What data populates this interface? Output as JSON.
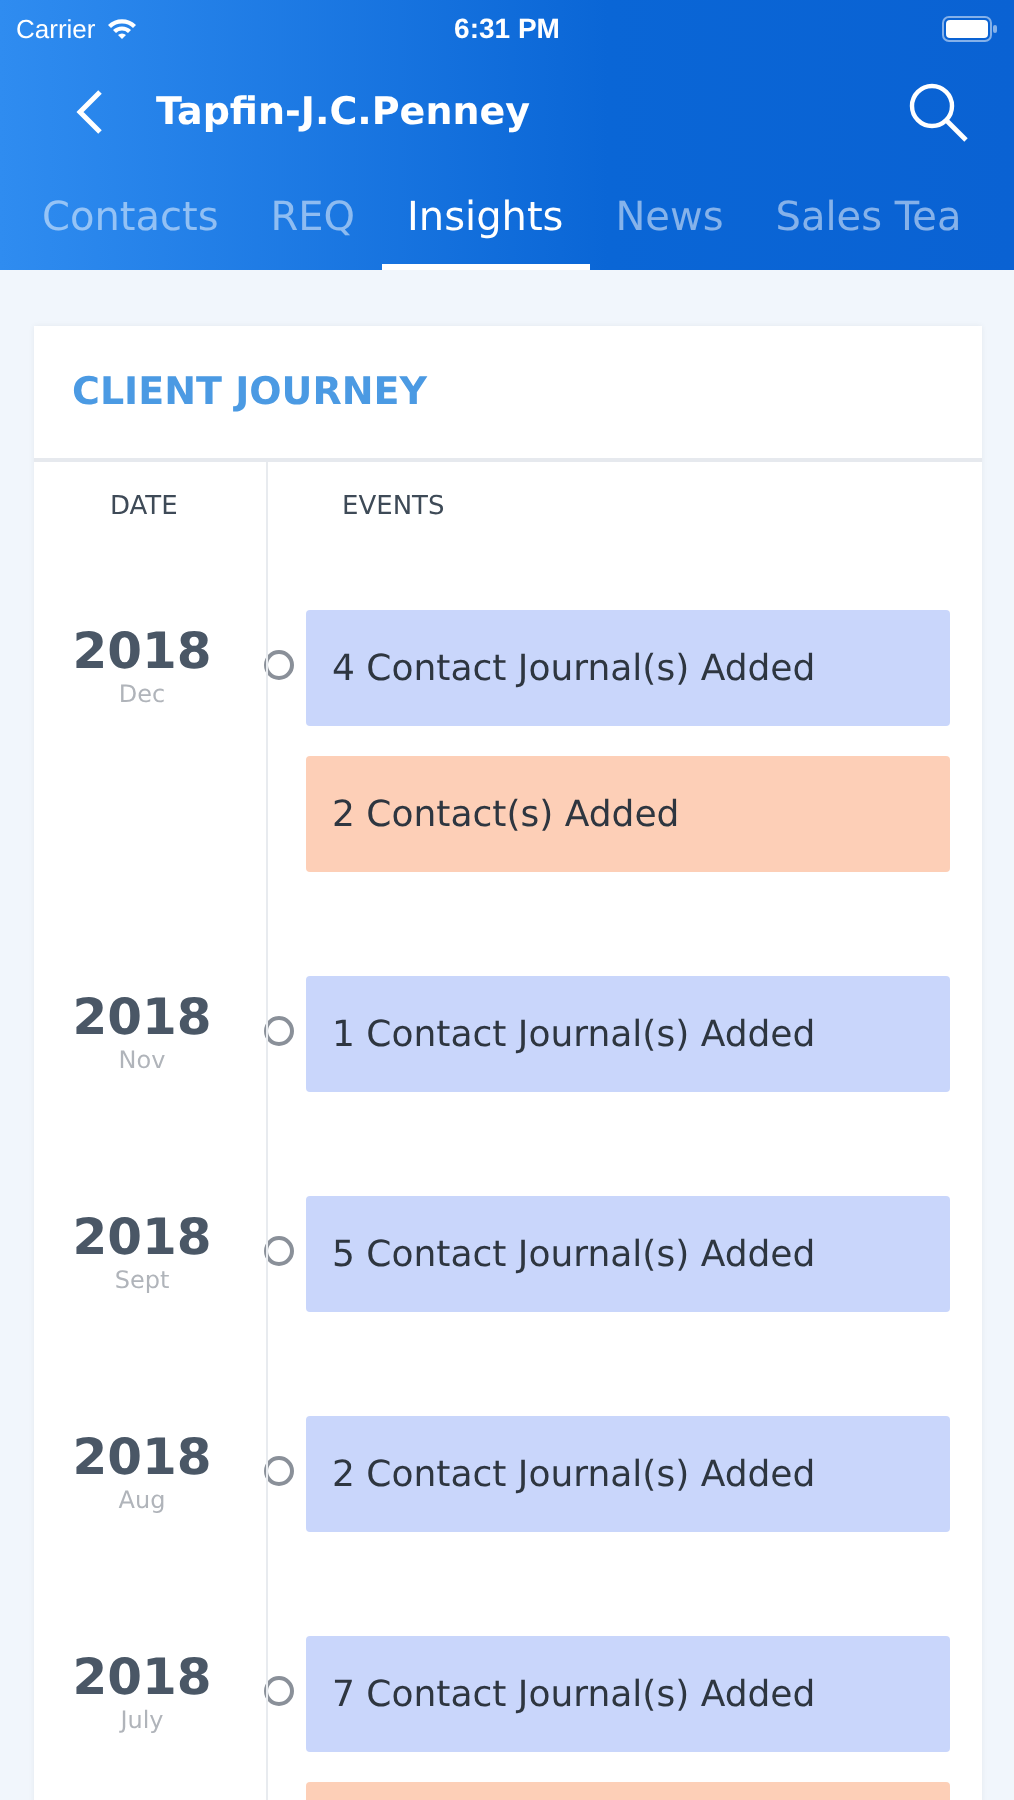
{
  "status_bar": {
    "carrier": "Carrier",
    "time": "6:31 PM"
  },
  "nav": {
    "title": "Tapfin-J.C.Penney"
  },
  "tabs": [
    {
      "label": "Contacts",
      "selected": false
    },
    {
      "label": "REQ",
      "selected": false
    },
    {
      "label": "Insights",
      "selected": true
    },
    {
      "label": "News",
      "selected": false
    },
    {
      "label": "Sales Tea",
      "selected": false
    }
  ],
  "card": {
    "title": "CLIENT JOURNEY",
    "columns": [
      "DATE",
      "EVENTS"
    ],
    "groups": [
      {
        "year": "2018",
        "month": "Dec",
        "events": [
          {
            "kind": "journal",
            "label": "4 Contact Journal(s) Added"
          },
          {
            "kind": "contact",
            "label": "2 Contact(s) Added"
          }
        ]
      },
      {
        "year": "2018",
        "month": "Nov",
        "events": [
          {
            "kind": "journal",
            "label": "1 Contact Journal(s) Added"
          }
        ]
      },
      {
        "year": "2018",
        "month": "Sept",
        "events": [
          {
            "kind": "journal",
            "label": "5 Contact Journal(s) Added"
          }
        ]
      },
      {
        "year": "2018",
        "month": "Aug",
        "events": [
          {
            "kind": "journal",
            "label": "2 Contact Journal(s) Added"
          }
        ]
      },
      {
        "year": "2018",
        "month": "July",
        "events": [
          {
            "kind": "journal",
            "label": "7 Contact Journal(s) Added"
          },
          {
            "kind": "contact"
          }
        ]
      }
    ]
  }
}
